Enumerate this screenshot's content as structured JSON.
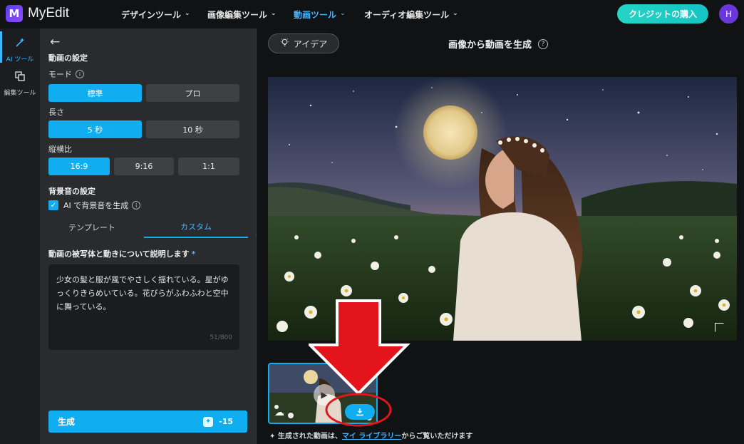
{
  "app": {
    "logo_letter": "M",
    "name": "MyEdit"
  },
  "nav": {
    "items": [
      {
        "label": "デザインツール"
      },
      {
        "label": "画像編集ツール"
      },
      {
        "label": "動画ツール"
      },
      {
        "label": "オーディオ編集ツール"
      }
    ],
    "credit_button": "クレジットの購入",
    "avatar": "H"
  },
  "rail": {
    "items": [
      {
        "label": "AI ツール"
      },
      {
        "label": "編集ツール"
      }
    ]
  },
  "panel": {
    "section_title": "動画の設定",
    "mode": {
      "label": "モード",
      "options": [
        "標準",
        "プロ"
      ],
      "selected": "標準"
    },
    "length": {
      "label": "長さ",
      "options": [
        "5 秒",
        "10 秒"
      ],
      "selected": "5 秒"
    },
    "aspect": {
      "label": "縦横比",
      "options": [
        "16:9",
        "9:16",
        "1:1"
      ],
      "selected": "16:9"
    },
    "bgm": {
      "title": "背景音の設定",
      "checkbox_label": "AI で背景音を生成",
      "checked": true
    },
    "tabs": [
      "テンプレート",
      "カスタム"
    ],
    "active_tab": "カスタム",
    "desc": {
      "title": "動画の被写体と動きについて説明します",
      "required_mark": "*",
      "value": "少女の髪と服が風でやさしく揺れている。星がゆっくりきらめいている。花びらがふわふわと空中に舞っている。",
      "counter": "51/800"
    },
    "generate": {
      "label": "生成",
      "cost": "-15"
    }
  },
  "main": {
    "idea_button": "アイデア",
    "title": "画像から動画を生成",
    "footnote_prefix": "生成された動画は、",
    "footnote_link": "マイ ライブラリー",
    "footnote_suffix": "からご覧いただけます"
  },
  "colors": {
    "accent": "#10aef0",
    "annotation_red": "#e3141b",
    "credit_gradient": "#25d4c4"
  }
}
